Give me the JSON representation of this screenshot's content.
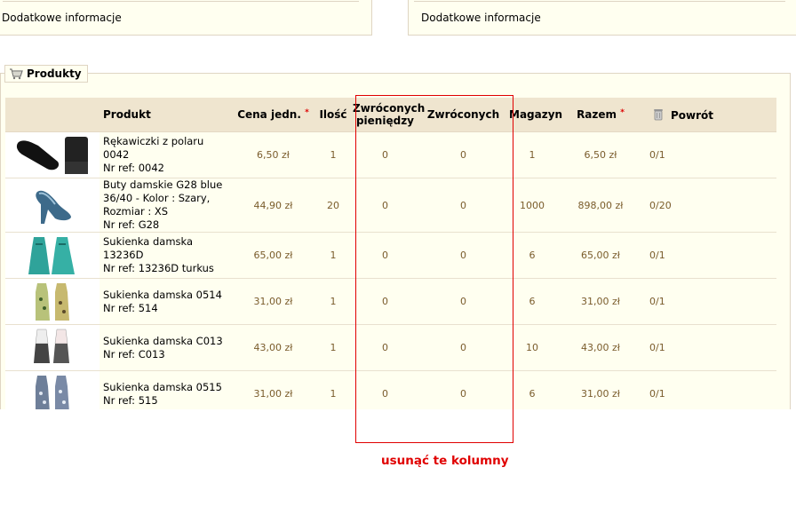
{
  "info": {
    "left_label": "Dodatkowe informacje",
    "right_label": "Dodatkowe informacje"
  },
  "products_section": {
    "legend": "Produkty",
    "legend_icon": "cart-icon"
  },
  "table": {
    "headers": {
      "product": "Produkt",
      "unit_price": "Cena jedn.",
      "quantity": "Ilość",
      "refunded_money_line1": "Zwróconych",
      "refunded_money_line2": "pieniędzy",
      "returned": "Zwróconych",
      "stock": "Magazyn",
      "total": "Razem",
      "return": "Powrót",
      "required_mark": "*",
      "return_icon": "trash-icon"
    },
    "rows": [
      {
        "name_lines": [
          "Rękawiczki z polaru 0042",
          "Nr ref: 0042"
        ],
        "price": "6,50 zł",
        "qty": "1",
        "refunded_money": "0",
        "returned": "0",
        "stock": "1",
        "total": "6,50 zł",
        "return": "0/1"
      },
      {
        "name_lines": [
          "Buty damskie G28 blue",
          "36/40 - Kolor : Szary,",
          "Rozmiar : XS",
          "Nr ref: G28"
        ],
        "price": "44,90 zł",
        "qty": "20",
        "refunded_money": "0",
        "returned": "0",
        "stock": "1000",
        "total": "898,00 zł",
        "return": "0/20"
      },
      {
        "name_lines": [
          "Sukienka damska",
          "13236D",
          "Nr ref: 13236D turkus"
        ],
        "price": "65,00 zł",
        "qty": "1",
        "refunded_money": "0",
        "returned": "0",
        "stock": "6",
        "total": "65,00 zł",
        "return": "0/1"
      },
      {
        "name_lines": [
          "Sukienka damska 0514",
          "Nr ref: 514"
        ],
        "price": "31,00 zł",
        "qty": "1",
        "refunded_money": "0",
        "returned": "0",
        "stock": "6",
        "total": "31,00 zł",
        "return": "0/1"
      },
      {
        "name_lines": [
          "Sukienka damska C013",
          "Nr ref: C013"
        ],
        "price": "43,00 zł",
        "qty": "1",
        "refunded_money": "0",
        "returned": "0",
        "stock": "10",
        "total": "43,00 zł",
        "return": "0/1"
      },
      {
        "name_lines": [
          "Sukienka damska 0515",
          "Nr ref: 515"
        ],
        "price": "31,00 zł",
        "qty": "1",
        "refunded_money": "0",
        "returned": "0",
        "stock": "6",
        "total": "31,00 zł",
        "return": "0/1"
      }
    ]
  },
  "annotation": {
    "text": "usunąć te kolumny",
    "color": "#e00000"
  }
}
